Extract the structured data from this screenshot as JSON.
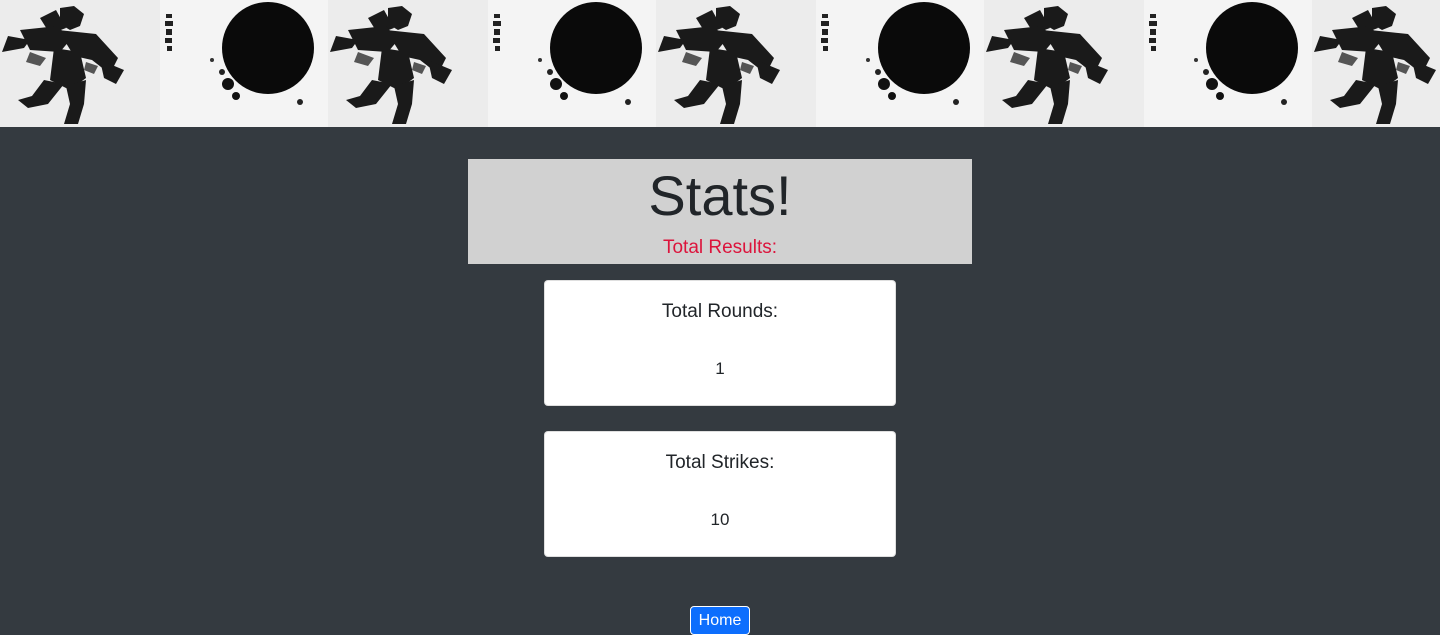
{
  "banner": {
    "tile_image": "ink-samurai-warrior-illustration"
  },
  "header": {
    "title": "Stats!",
    "subtitle": "Total Results:"
  },
  "cards": [
    {
      "label": "Total Rounds:",
      "value": "1"
    },
    {
      "label": "Total Strikes:",
      "value": "10"
    }
  ],
  "nav": {
    "home_label": "Home"
  },
  "colors": {
    "background": "#343a40",
    "header_bg": "#d1d1d1",
    "subtitle": "#dc143c",
    "button": "#0d6efd"
  }
}
